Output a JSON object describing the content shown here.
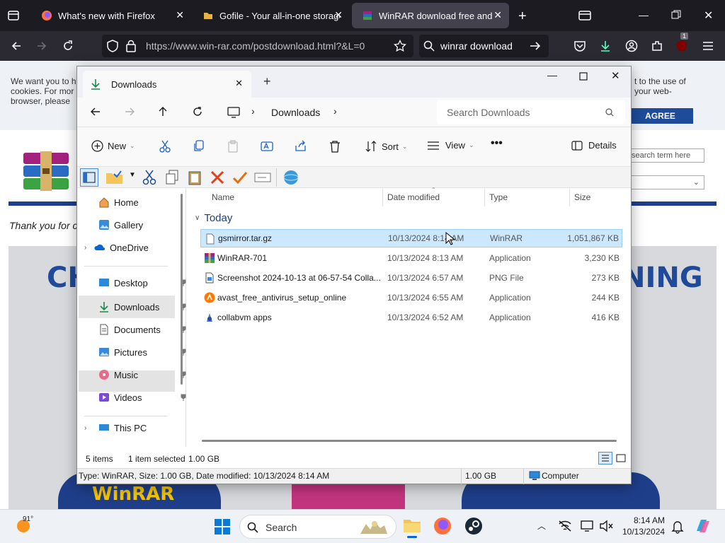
{
  "browser": {
    "tabs": [
      {
        "title": "What's new with Firefox"
      },
      {
        "title": "Gofile - Your all-in-one storage"
      },
      {
        "title": "WinRAR download free and sup"
      }
    ],
    "url": "https://www.win-rar.com/postdownload.html?&L=0",
    "search_text": "winrar download",
    "ext_badge": "1"
  },
  "website": {
    "cookie_text_left": [
      "We want you to h",
      "cookies. For mor",
      "browser, please"
    ],
    "cookie_text_right": [
      "t to the use of",
      "your web-"
    ],
    "agree_button": "AGREE",
    "search_placeholder": "search term here",
    "thank_you": "Thank you for c",
    "banner_left": "CH",
    "banner_right": "NING",
    "mascot_text": "WinRAR"
  },
  "explorer": {
    "tab_title": "Downloads",
    "breadcrumb": "Downloads",
    "search_placeholder": "Search Downloads",
    "commands": {
      "new": "New",
      "sort": "Sort",
      "view": "View",
      "details": "Details"
    },
    "nav": [
      {
        "label": "Home"
      },
      {
        "label": "Gallery"
      },
      {
        "label": "OneDrive"
      },
      {
        "label": "Desktop"
      },
      {
        "label": "Downloads"
      },
      {
        "label": "Documents"
      },
      {
        "label": "Pictures"
      },
      {
        "label": "Music"
      },
      {
        "label": "Videos"
      },
      {
        "label": "This PC"
      }
    ],
    "columns": {
      "name": "Name",
      "date": "Date modified",
      "type": "Type",
      "size": "Size"
    },
    "group": "Today",
    "files": [
      {
        "name": "gsmirror.tar.gz",
        "date": "10/13/2024 8:14 AM",
        "type": "WinRAR",
        "size": "1,051,867 KB"
      },
      {
        "name": "WinRAR-701",
        "date": "10/13/2024 8:13 AM",
        "type": "Application",
        "size": "3,230 KB"
      },
      {
        "name": "Screenshot 2024-10-13 at 06-57-54 Colla...",
        "date": "10/13/2024 6:57 AM",
        "type": "PNG File",
        "size": "273 KB"
      },
      {
        "name": "avast_free_antivirus_setup_online",
        "date": "10/13/2024 6:55 AM",
        "type": "Application",
        "size": "244 KB"
      },
      {
        "name": "collabvm apps",
        "date": "10/13/2024 6:52 AM",
        "type": "Application",
        "size": "416 KB"
      }
    ],
    "status": {
      "items": "5 items",
      "selected": "1 item selected",
      "size": "1.00 GB"
    },
    "status2": {
      "info": "Type: WinRAR, Size: 1.00 GB, Date modified: 10/13/2024 8:14 AM",
      "size": "1.00 GB",
      "location": "Computer"
    }
  },
  "taskbar": {
    "weather": "91°",
    "search": "Search",
    "time": "8:14 AM",
    "date": "10/13/2024"
  },
  "colors": {
    "accent": "#0067c0",
    "selection": "#cce8ff",
    "firefox_dark": "#1c1b22"
  }
}
